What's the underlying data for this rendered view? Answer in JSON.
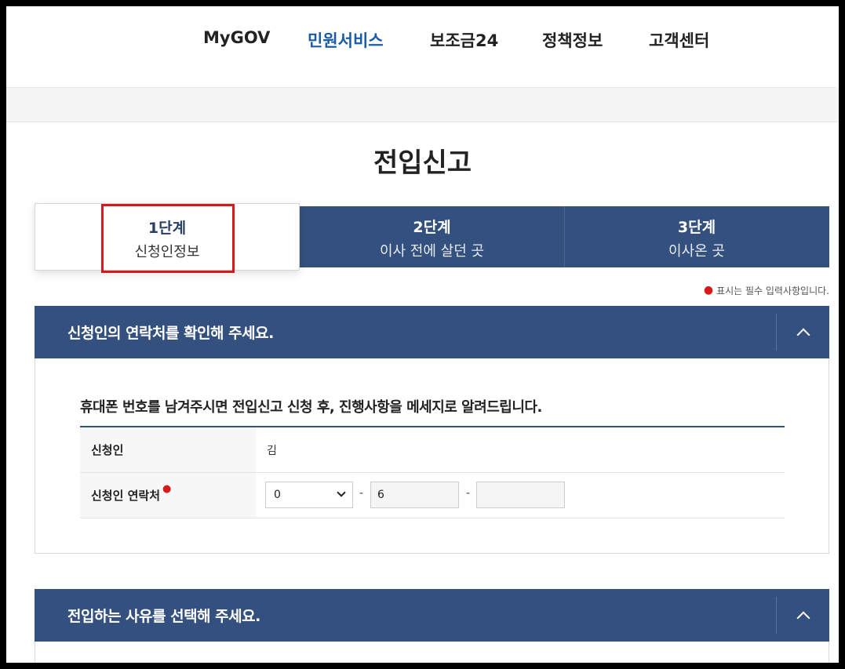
{
  "nav": {
    "items": [
      {
        "label": "MyGOV",
        "active": false
      },
      {
        "label": "민원서비스",
        "active": true
      },
      {
        "label": "보조금24",
        "active": false
      },
      {
        "label": "정책정보",
        "active": false
      },
      {
        "label": "고객센터",
        "active": false
      }
    ]
  },
  "page": {
    "title": "전입신고"
  },
  "steps": [
    {
      "num": "1단계",
      "label": "신청인정보",
      "active": true
    },
    {
      "num": "2단계",
      "label": "이사 전에 살던 곳",
      "active": false
    },
    {
      "num": "3단계",
      "label": "이사온 곳",
      "active": false
    }
  ],
  "required_note": "표시는 필수 입력사항입니다.",
  "section1": {
    "title": "신청인의 연락처를 확인해 주세요.",
    "info": "휴대폰 번호를 남겨주시면 전입신고 신청 후, 진행사항을 메세지로 알려드립니다.",
    "applicant_label": "신청인",
    "applicant_value": "김",
    "contact_label": "신청인 연락처",
    "phone_prefix": "0",
    "phone_mid": "6",
    "phone_last": "",
    "dash": "-"
  },
  "section2": {
    "title": "전입하는 사유를 선택해 주세요."
  },
  "colors": {
    "primary": "#34507e",
    "accent": "#1a5ca8",
    "required": "#d7191c"
  }
}
